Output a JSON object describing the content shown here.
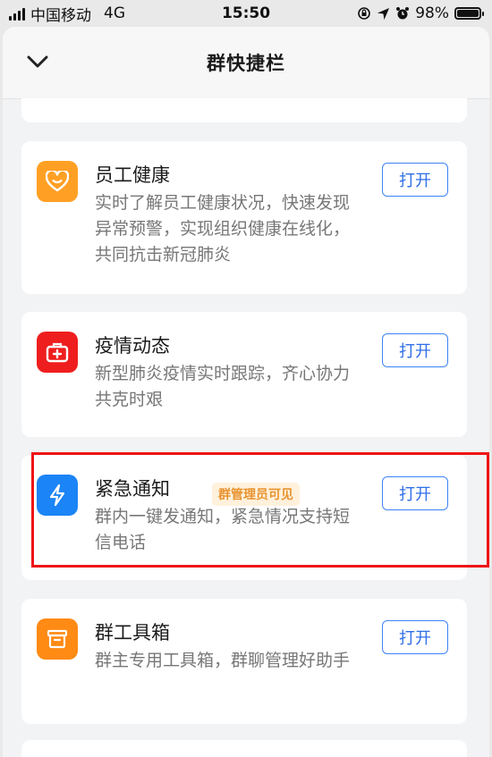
{
  "status_bar": {
    "carrier": "中国移动",
    "network": "4G",
    "time": "15:50",
    "battery_text": "98%",
    "battery_level": 0.98
  },
  "sheet": {
    "title": "群快捷栏"
  },
  "cards": [
    {
      "name": "员工健康",
      "desc": "实时了解员工健康状况，快速发现异常预警，实现组织健康在线化，共同抗击新冠肺炎",
      "button": "打开",
      "color": "#ffa024"
    },
    {
      "name": "疫情动态",
      "desc": "新型肺炎疫情实时跟踪，齐心协力共克时艰",
      "button": "打开",
      "color": "#ef1e1e"
    },
    {
      "name": "紧急通知",
      "badge": "群管理员可见",
      "desc": "群内一键发通知，紧急情况支持短信电话",
      "button": "打开",
      "color": "#1b84f6"
    },
    {
      "name": "群工具箱",
      "desc": "群主专用工具箱，群聊管理好助手",
      "button": "打开",
      "color": "#ff8a14"
    }
  ]
}
